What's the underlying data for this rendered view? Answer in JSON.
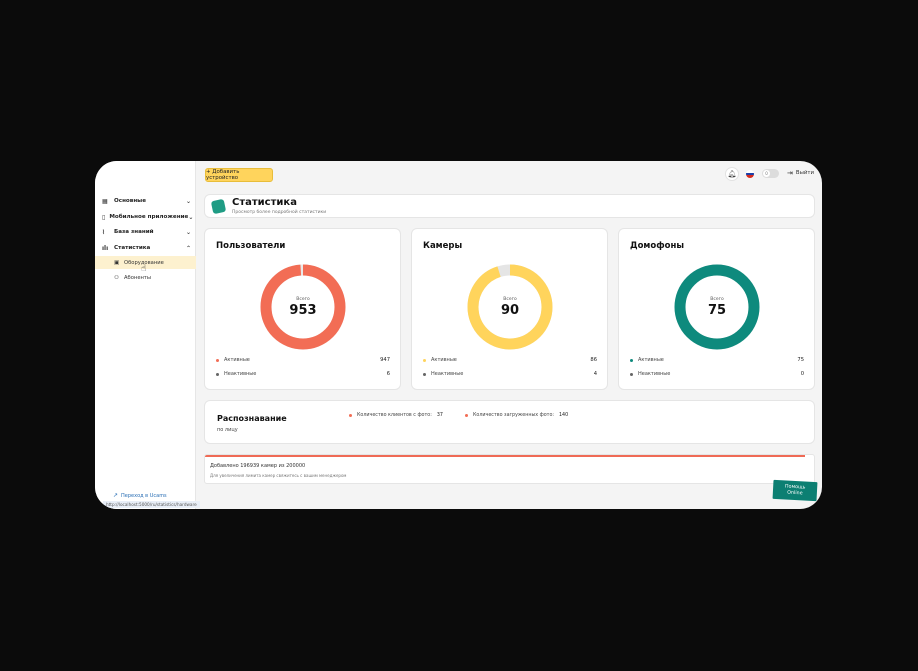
{
  "sidebar": {
    "items": [
      {
        "label": "Основные",
        "icon": "grid-icon",
        "chevron": "⌄"
      },
      {
        "label": "Мобильное приложение",
        "icon": "phone-icon",
        "chevron": "⌄"
      },
      {
        "label": "База знаний",
        "icon": "paperclip-icon",
        "chevron": "⌄"
      },
      {
        "label": "Статистика",
        "icon": "bar-chart-icon",
        "chevron": "⌃"
      }
    ],
    "subitems": [
      {
        "label": "Оборудование",
        "icon": "device-icon",
        "active": true
      },
      {
        "label": "Абоненты",
        "icon": "users-icon",
        "active": false
      }
    ],
    "bottom_link": "Переход в Ucams",
    "status_url": "http://localhost:5000/ru/statistics/hardware"
  },
  "topbar": {
    "add_button": "+ Добавить устройство",
    "logout": "Выйти",
    "toggle_mark": "0"
  },
  "header": {
    "title": "Статистика",
    "subtitle": "Просмотр более подробной статистики"
  },
  "stats": [
    {
      "title": "Пользователи",
      "total_label": "Всего",
      "total": "953",
      "active_label": "Активные",
      "active": "947",
      "inactive_label": "Неактивные",
      "inactive": "6",
      "active_color": "#f26d55",
      "inactive_color": "#e9e9e9"
    },
    {
      "title": "Камеры",
      "total_label": "Всего",
      "total": "90",
      "active_label": "Активные",
      "active": "86",
      "inactive_label": "Неактивные",
      "inactive": "4",
      "active_color": "#ffd45c",
      "inactive_color": "#e5e5e5"
    },
    {
      "title": "Домофоны",
      "total_label": "Всего",
      "total": "75",
      "active_label": "Активные",
      "active": "75",
      "inactive_label": "Неактивные",
      "inactive": "0",
      "active_color": "#0e8a7d",
      "inactive_color": "#e5e5e5"
    }
  ],
  "recognition": {
    "title": "Распознавание",
    "subtitle": "по лицу",
    "clients_label": "Количество клиентов с фото:",
    "clients_value": "37",
    "photos_label": "Количество загруженных фото:",
    "photos_value": "140",
    "dot_color": "#f26d55"
  },
  "progress": {
    "text": "Добавлено 196939 камер из 200000",
    "note": "Для увеличения лимита камер свяжитесь с вашим менеджером",
    "fraction": 0.9847
  },
  "help": {
    "line1": "Помощь",
    "line2": "Online"
  },
  "colors": {
    "accent": "#ffd45c",
    "teal": "#0e8a7d",
    "red": "#f26d55"
  }
}
